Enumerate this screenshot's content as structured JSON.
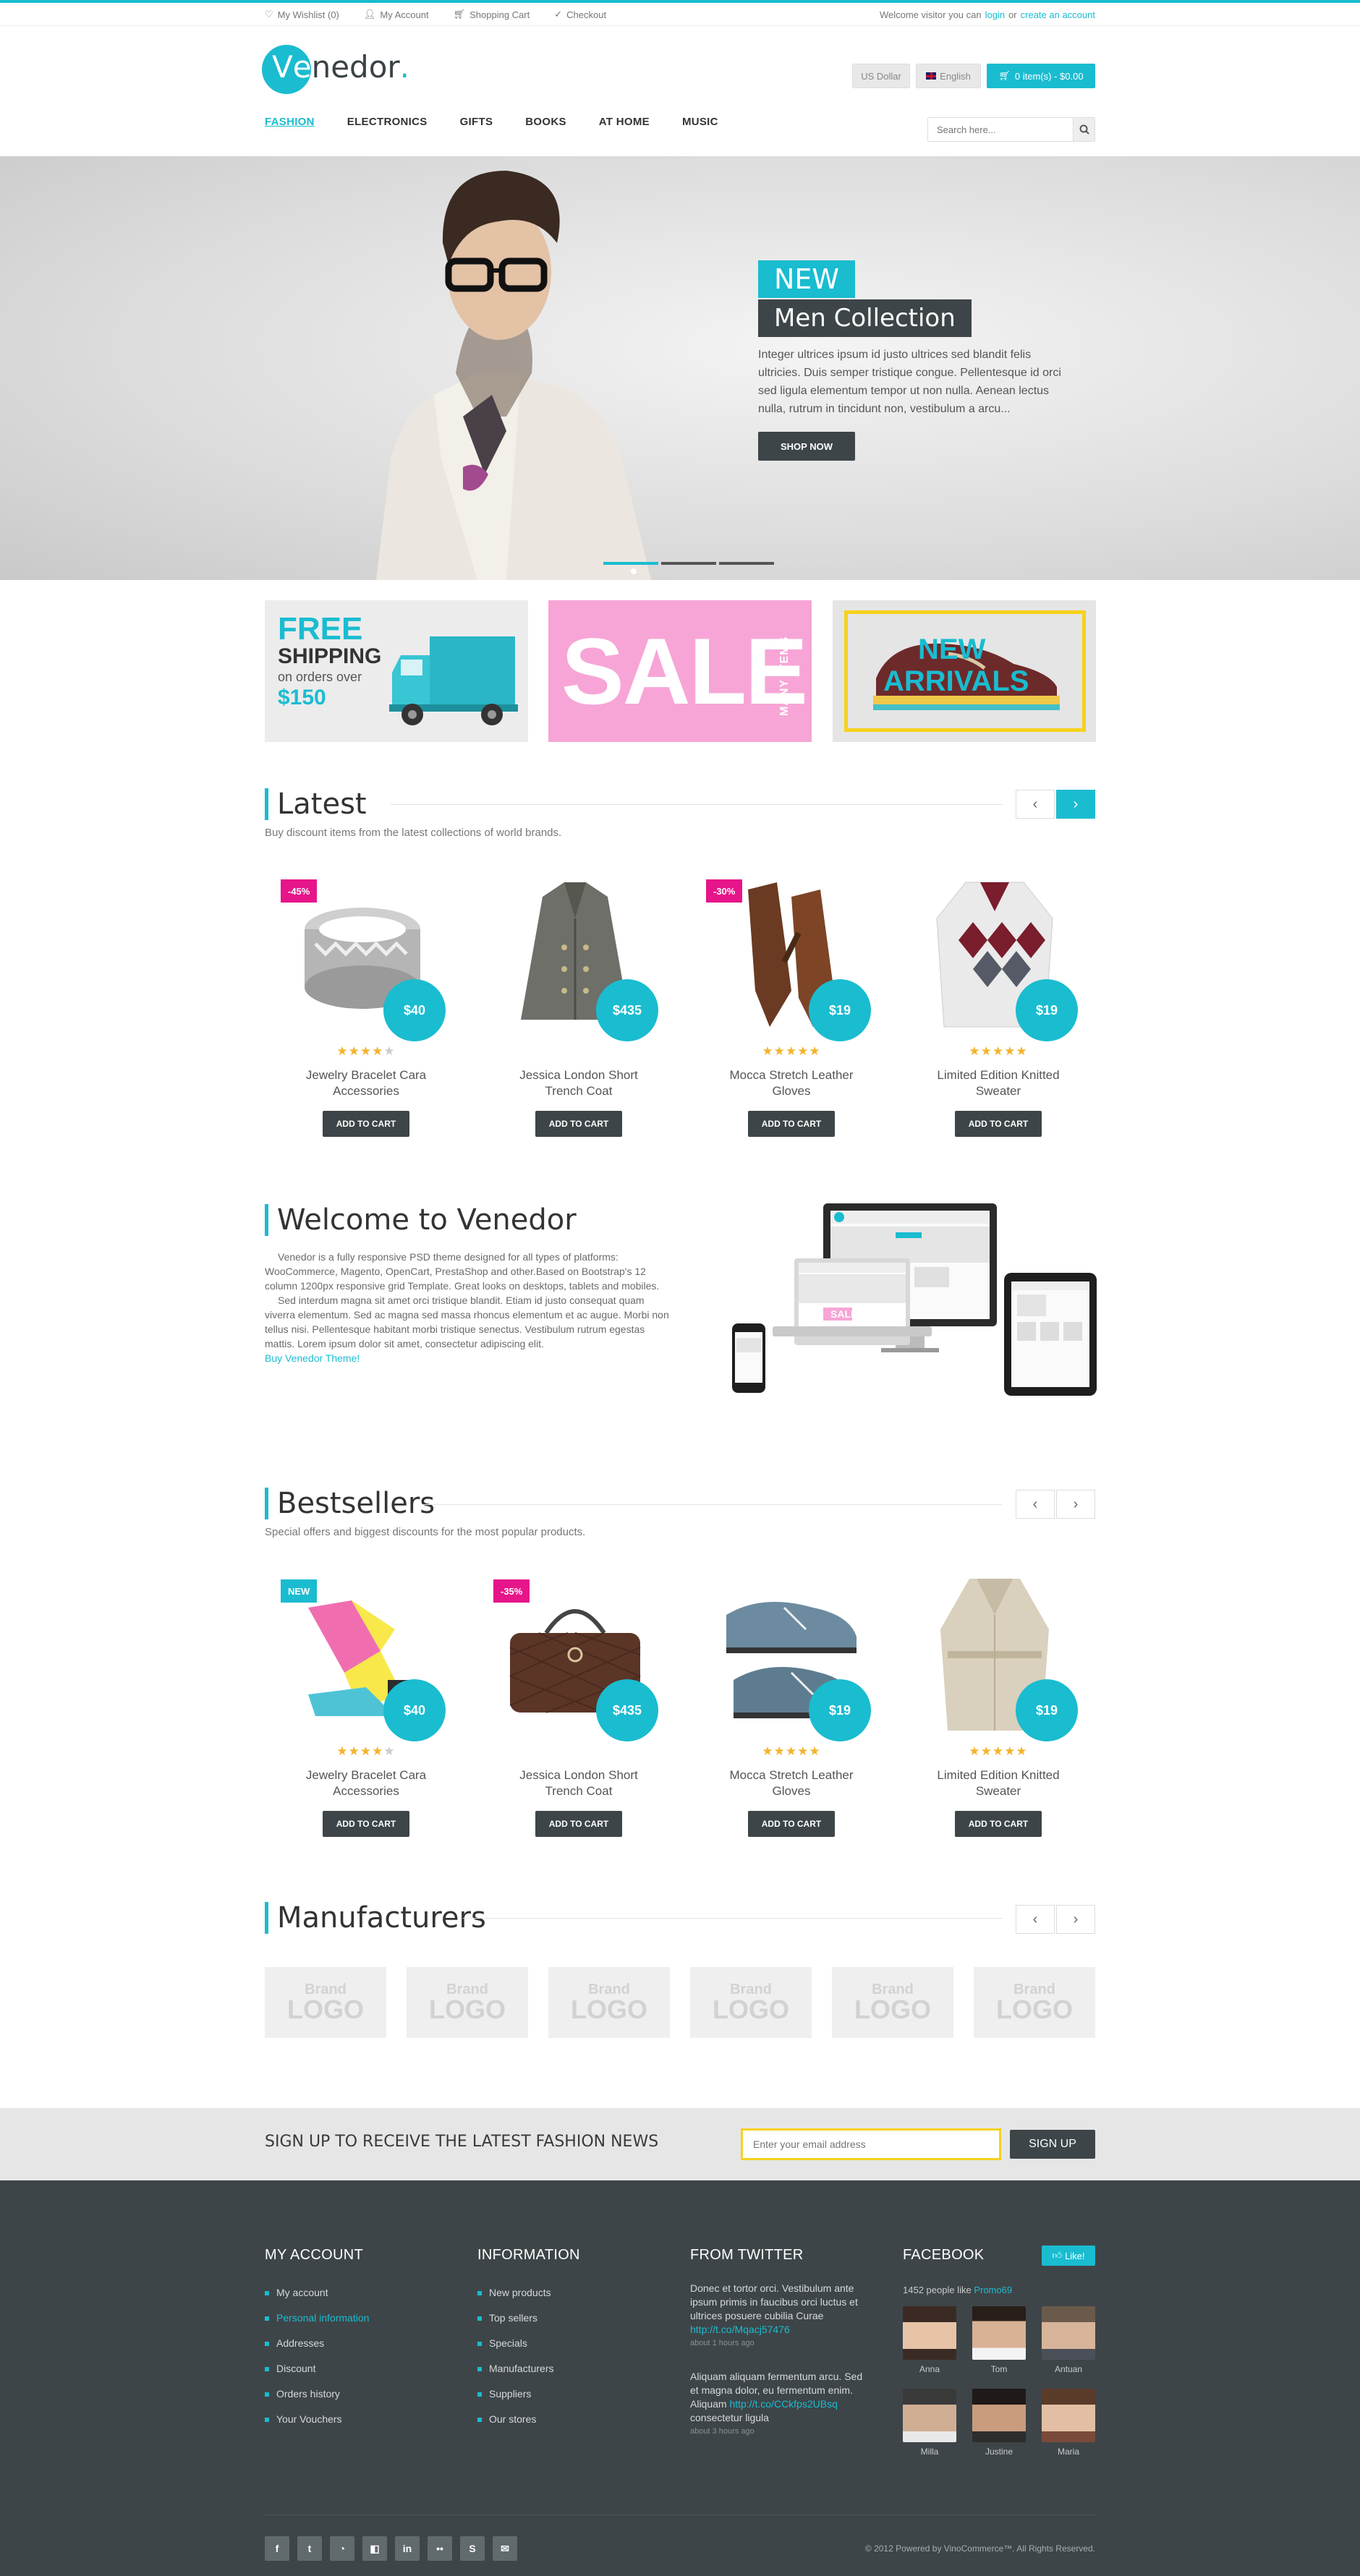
{
  "topbar": {
    "links": [
      {
        "icon": "heart-icon",
        "label": "My Wishlist (0)"
      },
      {
        "icon": "user-icon",
        "label": "My Account"
      },
      {
        "icon": "cart-icon",
        "label": "Shopping Cart"
      },
      {
        "icon": "check-icon",
        "label": "Checkout"
      }
    ],
    "welcome": "Welcome visitor you can",
    "login": "login",
    "or": "or",
    "create": "create an account"
  },
  "header": {
    "logo_v": "V",
    "logo_e": "e",
    "logo_rest": "nedor",
    "logo_dot": ".",
    "currency": "US Dollar",
    "language": "English",
    "cart": "0 item(s) - $0.00"
  },
  "nav": {
    "items": [
      "FASHION",
      "ELECTRONICS",
      "GIFTS",
      "BOOKS",
      "AT HOME",
      "MUSIC"
    ],
    "active": "FASHION",
    "search_placeholder": "Search here..."
  },
  "hero": {
    "badge": "NEW",
    "title": "Men Collection",
    "text": "Integer ultrices ipsum id justo ultrices sed blandit felis ultricies. Duis semper tristique congue. Pellentesque id orci sed ligula elementum tempor ut non nulla. Aenean lectus nulla, rutrum in tincidunt non, vestibulum a arcu...",
    "button": "SHOP NOW"
  },
  "banners": {
    "shipping": {
      "free": "FREE",
      "shipping": "SHIPPING",
      "on_orders": "on orders over",
      "amount": "$150"
    },
    "sale": {
      "text": "SALE",
      "side": "MANY ITEMS"
    },
    "arrivals": {
      "new": "NEW",
      "arrivals": "ARRIVALS"
    }
  },
  "latest": {
    "title": "Latest",
    "subtitle": "Buy discount items from the latest collections of world brands.",
    "products": [
      {
        "name1": "Jewelry Bracelet Cara",
        "name2": "Accessories",
        "price": "$40",
        "tag": "-45%",
        "stars": 4
      },
      {
        "name1": "Jessica London Short",
        "name2": "Trench Coat",
        "price": "$435",
        "tag": "",
        "stars": 0
      },
      {
        "name1": "Mocca Stretch Leather",
        "name2": "Gloves",
        "price": "$19",
        "tag": "-30%",
        "stars": 5
      },
      {
        "name1": "Limited Edition Knitted",
        "name2": "Sweater",
        "price": "$19",
        "tag": "",
        "stars": 5
      }
    ],
    "add_to_cart": "ADD TO CART"
  },
  "welcome": {
    "title": "Welcome to Venedor",
    "p1": "Venedor is a fully responsive PSD theme designed for all types of platforms: WooCommerce, Magento, OpenCart, PrestaShop and other.Based on Bootstrap's 12 column 1200px responsive grid Template. Great looks on desktops, tablets and mobiles.",
    "p2": "Sed interdum magna sit amet orci tristique blandit. Etiam id justo consequat quam viverra elementum. Sed ac magna sed massa rhoncus elementum et ac augue. Morbi non tellus nisi. Pellentesque habitant morbi tristique senectus.  Vestibulum rutrum egestas mattis. Lorem ipsum dolor sit amet, consectetur adipiscing elit.",
    "link": "Buy Venedor Theme!",
    "device_sale": "SALE"
  },
  "bestsellers": {
    "title": "Bestsellers",
    "subtitle": "Special offers and biggest discounts for the most popular products.",
    "products": [
      {
        "name1": "Jewelry Bracelet Cara",
        "name2": "Accessories",
        "price": "$40",
        "tag": "NEW",
        "stars": 4
      },
      {
        "name1": "Jessica London Short",
        "name2": "Trench Coat",
        "price": "$435",
        "tag": "-35%",
        "stars": 0
      },
      {
        "name1": "Mocca Stretch Leather",
        "name2": "Gloves",
        "price": "$19",
        "tag": "",
        "stars": 5
      },
      {
        "name1": "Limited Edition Knitted",
        "name2": "Sweater",
        "price": "$19",
        "tag": "",
        "stars": 5
      }
    ],
    "add_to_cart": "ADD TO CART"
  },
  "manufacturers": {
    "title": "Manufacturers",
    "brand_top": "Brand",
    "brand_bottom": "LOGO"
  },
  "newsletter": {
    "heading": "SIGN UP TO RECEIVE THE LATEST FASHION NEWS",
    "placeholder": "Enter your email address",
    "button": "SIGN UP"
  },
  "footer": {
    "account": {
      "title": "MY ACCOUNT",
      "items": [
        "My account",
        "Personal information",
        "Addresses",
        "Discount",
        "Orders history",
        "Your Vouchers"
      ]
    },
    "information": {
      "title": "INFORMATION",
      "items": [
        "New products",
        "Top sellers",
        "Specials",
        "Manufacturers",
        "Suppliers",
        "Our stores"
      ]
    },
    "twitter": {
      "title": "FROM TWITTER",
      "tweets": [
        {
          "l1": "Donec et tortor orci. Vestibulum ante",
          "l2": "ipsum primis in faucibus orci luctus et",
          "l3": "ultrices posuere cubilia Curae",
          "link": "http://t.co/Mqacj57476",
          "after": "",
          "ago": "about 1 hours ago"
        },
        {
          "l1": "Aliquam aliquam fermentum arcu. Sed",
          "l2": "et magna dolor, eu fermentum enim.",
          "l3": "Aliquam",
          "link": "http://t.co/CCkfps2UBsq",
          "after": "consectetur ligula",
          "ago": "about 3 hours ago"
        }
      ]
    },
    "facebook": {
      "title": "FACEBOOK",
      "like": "Like!",
      "count": "1452 people like",
      "page": "Promo69",
      "people": [
        "Anna",
        "Tom",
        "Antuan",
        "Milla",
        "Justine",
        "Maria"
      ]
    },
    "social": [
      "f",
      "t",
      "rss",
      "delicious",
      "in",
      "flickr",
      "skype",
      "mail"
    ],
    "copyright": "© 2012 Powered by VinoCommerce™. All Rights Reserved."
  },
  "colors": {
    "accent": "#1abcd0",
    "dark": "#3e4548",
    "pink": "#e6158a"
  }
}
